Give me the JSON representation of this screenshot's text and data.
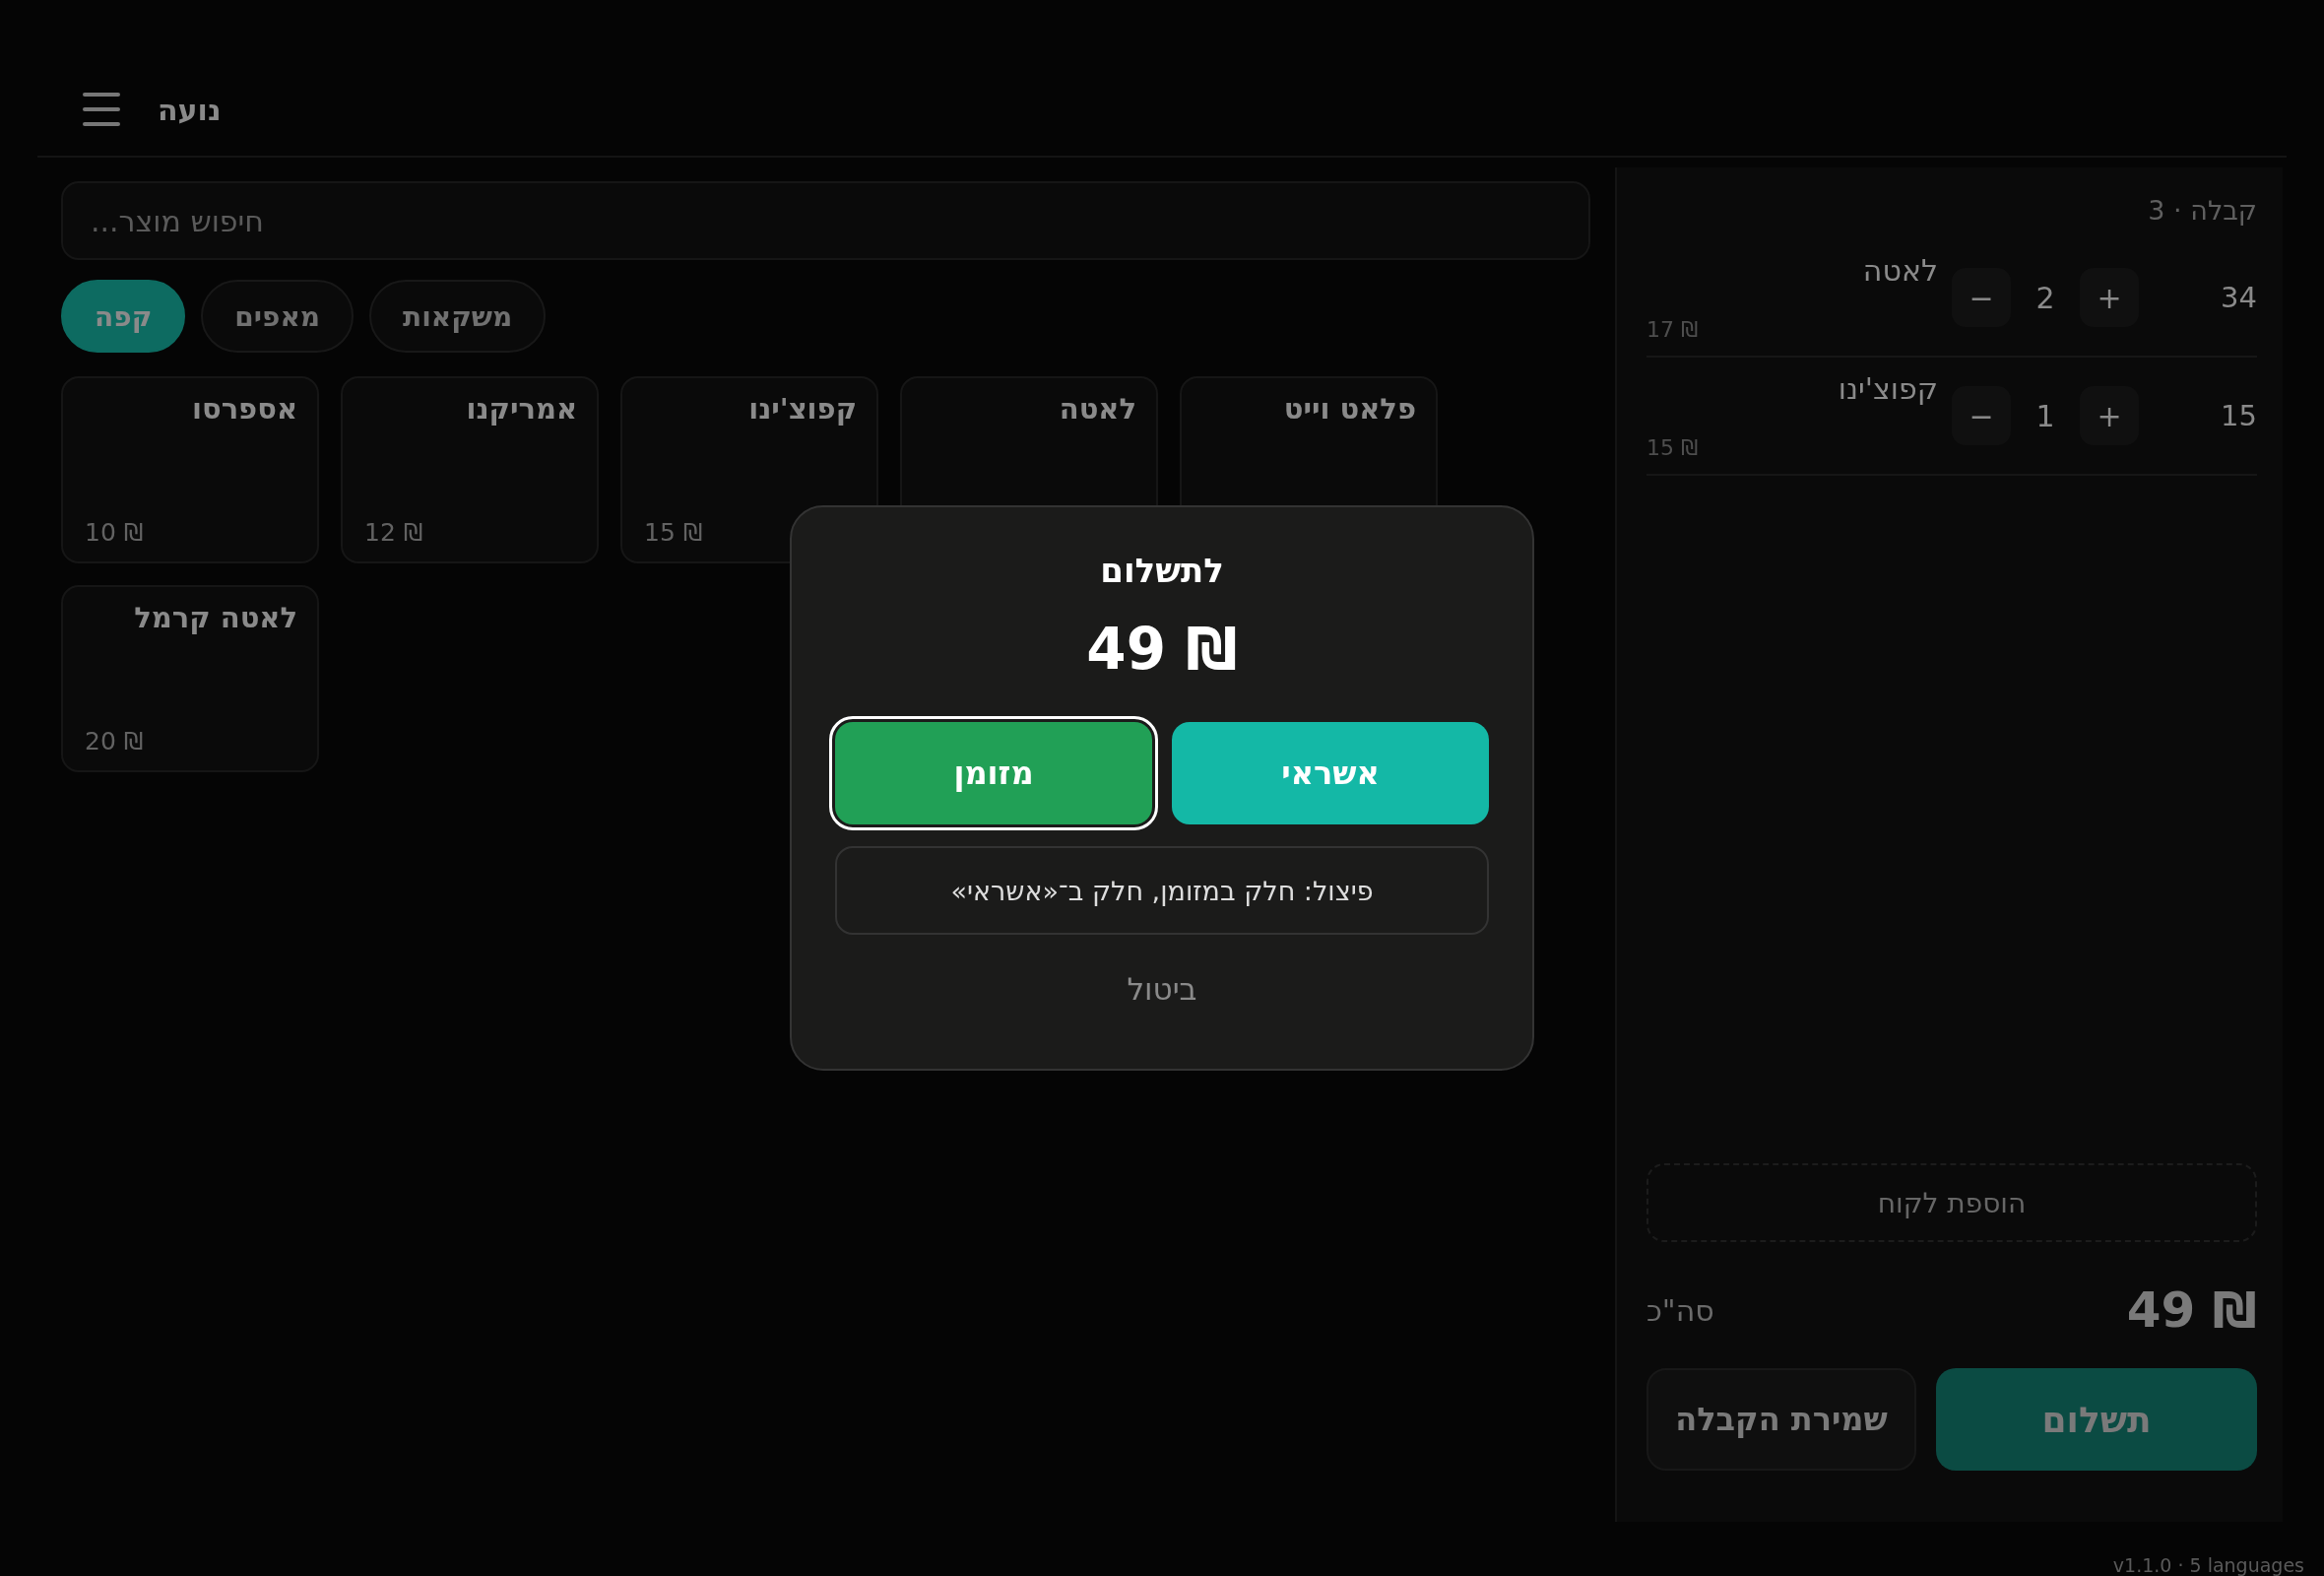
{
  "header": {
    "title": "נועה"
  },
  "search": {
    "placeholder": "חיפוש מוצר..."
  },
  "categories": [
    {
      "label": "משקאות",
      "selected": false
    },
    {
      "label": "מאפים",
      "selected": false
    },
    {
      "label": "קפה",
      "selected": true
    }
  ],
  "products": [
    {
      "name": "פלאט וייט"
    },
    {
      "name": "לאטה"
    },
    {
      "name": "קפוצ'ינו",
      "price": "15 ₪"
    },
    {
      "name": "אמריקנו",
      "price": "12 ₪"
    },
    {
      "name": "אספרסו",
      "price": "10 ₪"
    },
    {
      "name": "לאטה קרמל",
      "price": "20 ₪"
    }
  ],
  "receipt": {
    "title": "קבלה · 3",
    "lines": [
      {
        "name": "לאטה",
        "unit_price": "17 ₪",
        "minus": "−",
        "quantity": "2",
        "plus": "+",
        "total": "34"
      },
      {
        "name": "קפוצ'ינו",
        "unit_price": "15 ₪",
        "minus": "−",
        "quantity": "1",
        "plus": "+",
        "total": "15"
      }
    ],
    "add_customer": "הוספת לקוח",
    "total_label": "סה\"כ",
    "total": "49 ₪",
    "save_button": "שמירת הקבלה",
    "pay_button": "תשלום"
  },
  "payment_dialog": {
    "title": "לתשלום",
    "amount": "49 ₪",
    "methods": [
      {
        "label": "אשראי",
        "kind": "card",
        "selected": false
      },
      {
        "label": "מזומן",
        "kind": "cash",
        "selected": true
      }
    ],
    "split_button": "פיצול: חלק במזומן, חלק ב־«אשראי»",
    "cancel": "ביטול"
  },
  "footer": {
    "version": "v1.1.0 · 5 languages"
  }
}
